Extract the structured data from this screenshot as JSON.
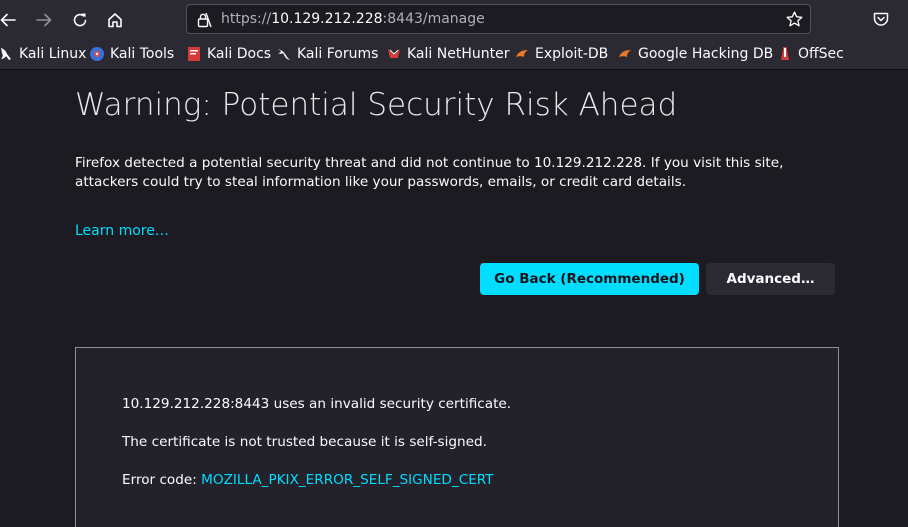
{
  "toolbar": {
    "url_scheme": "https://",
    "url_host": "10.129.212.228",
    "url_rest": ":8443/manage"
  },
  "bookmarks": [
    {
      "label": "Kali Linux",
      "icon": "kali-dragon-icon"
    },
    {
      "label": "Kali Tools",
      "icon": "kali-tools-icon"
    },
    {
      "label": "Kali Docs",
      "icon": "kali-docs-icon"
    },
    {
      "label": "Kali Forums",
      "icon": "kali-forums-icon"
    },
    {
      "label": "Kali NetHunter",
      "icon": "kali-nethunter-icon"
    },
    {
      "label": "Exploit-DB",
      "icon": "exploit-db-icon"
    },
    {
      "label": "Google Hacking DB",
      "icon": "google-hacking-db-icon"
    },
    {
      "label": "OffSec",
      "icon": "offsec-icon"
    }
  ],
  "page": {
    "title": "Warning: Potential Security Risk Ahead",
    "description": "Firefox detected a potential security threat and did not continue to 10.129.212.228. If you visit this site, attackers could try to steal information like your passwords, emails, or credit card details.",
    "learn_more": "Learn more…",
    "go_back_label": "Go Back (Recommended)",
    "advanced_label": "Advanced…"
  },
  "details": {
    "invalid_cert": "10.129.212.228:8443 uses an invalid security certificate.",
    "not_trusted": "The certificate is not trusted because it is self-signed.",
    "error_code_label": "Error code: ",
    "error_code": "MOZILLA_PKIX_ERROR_SELF_SIGNED_CERT"
  },
  "colors": {
    "accent": "#00ddff",
    "page_bg": "#1c1b22",
    "toolbar_bg": "#2b2a33"
  }
}
